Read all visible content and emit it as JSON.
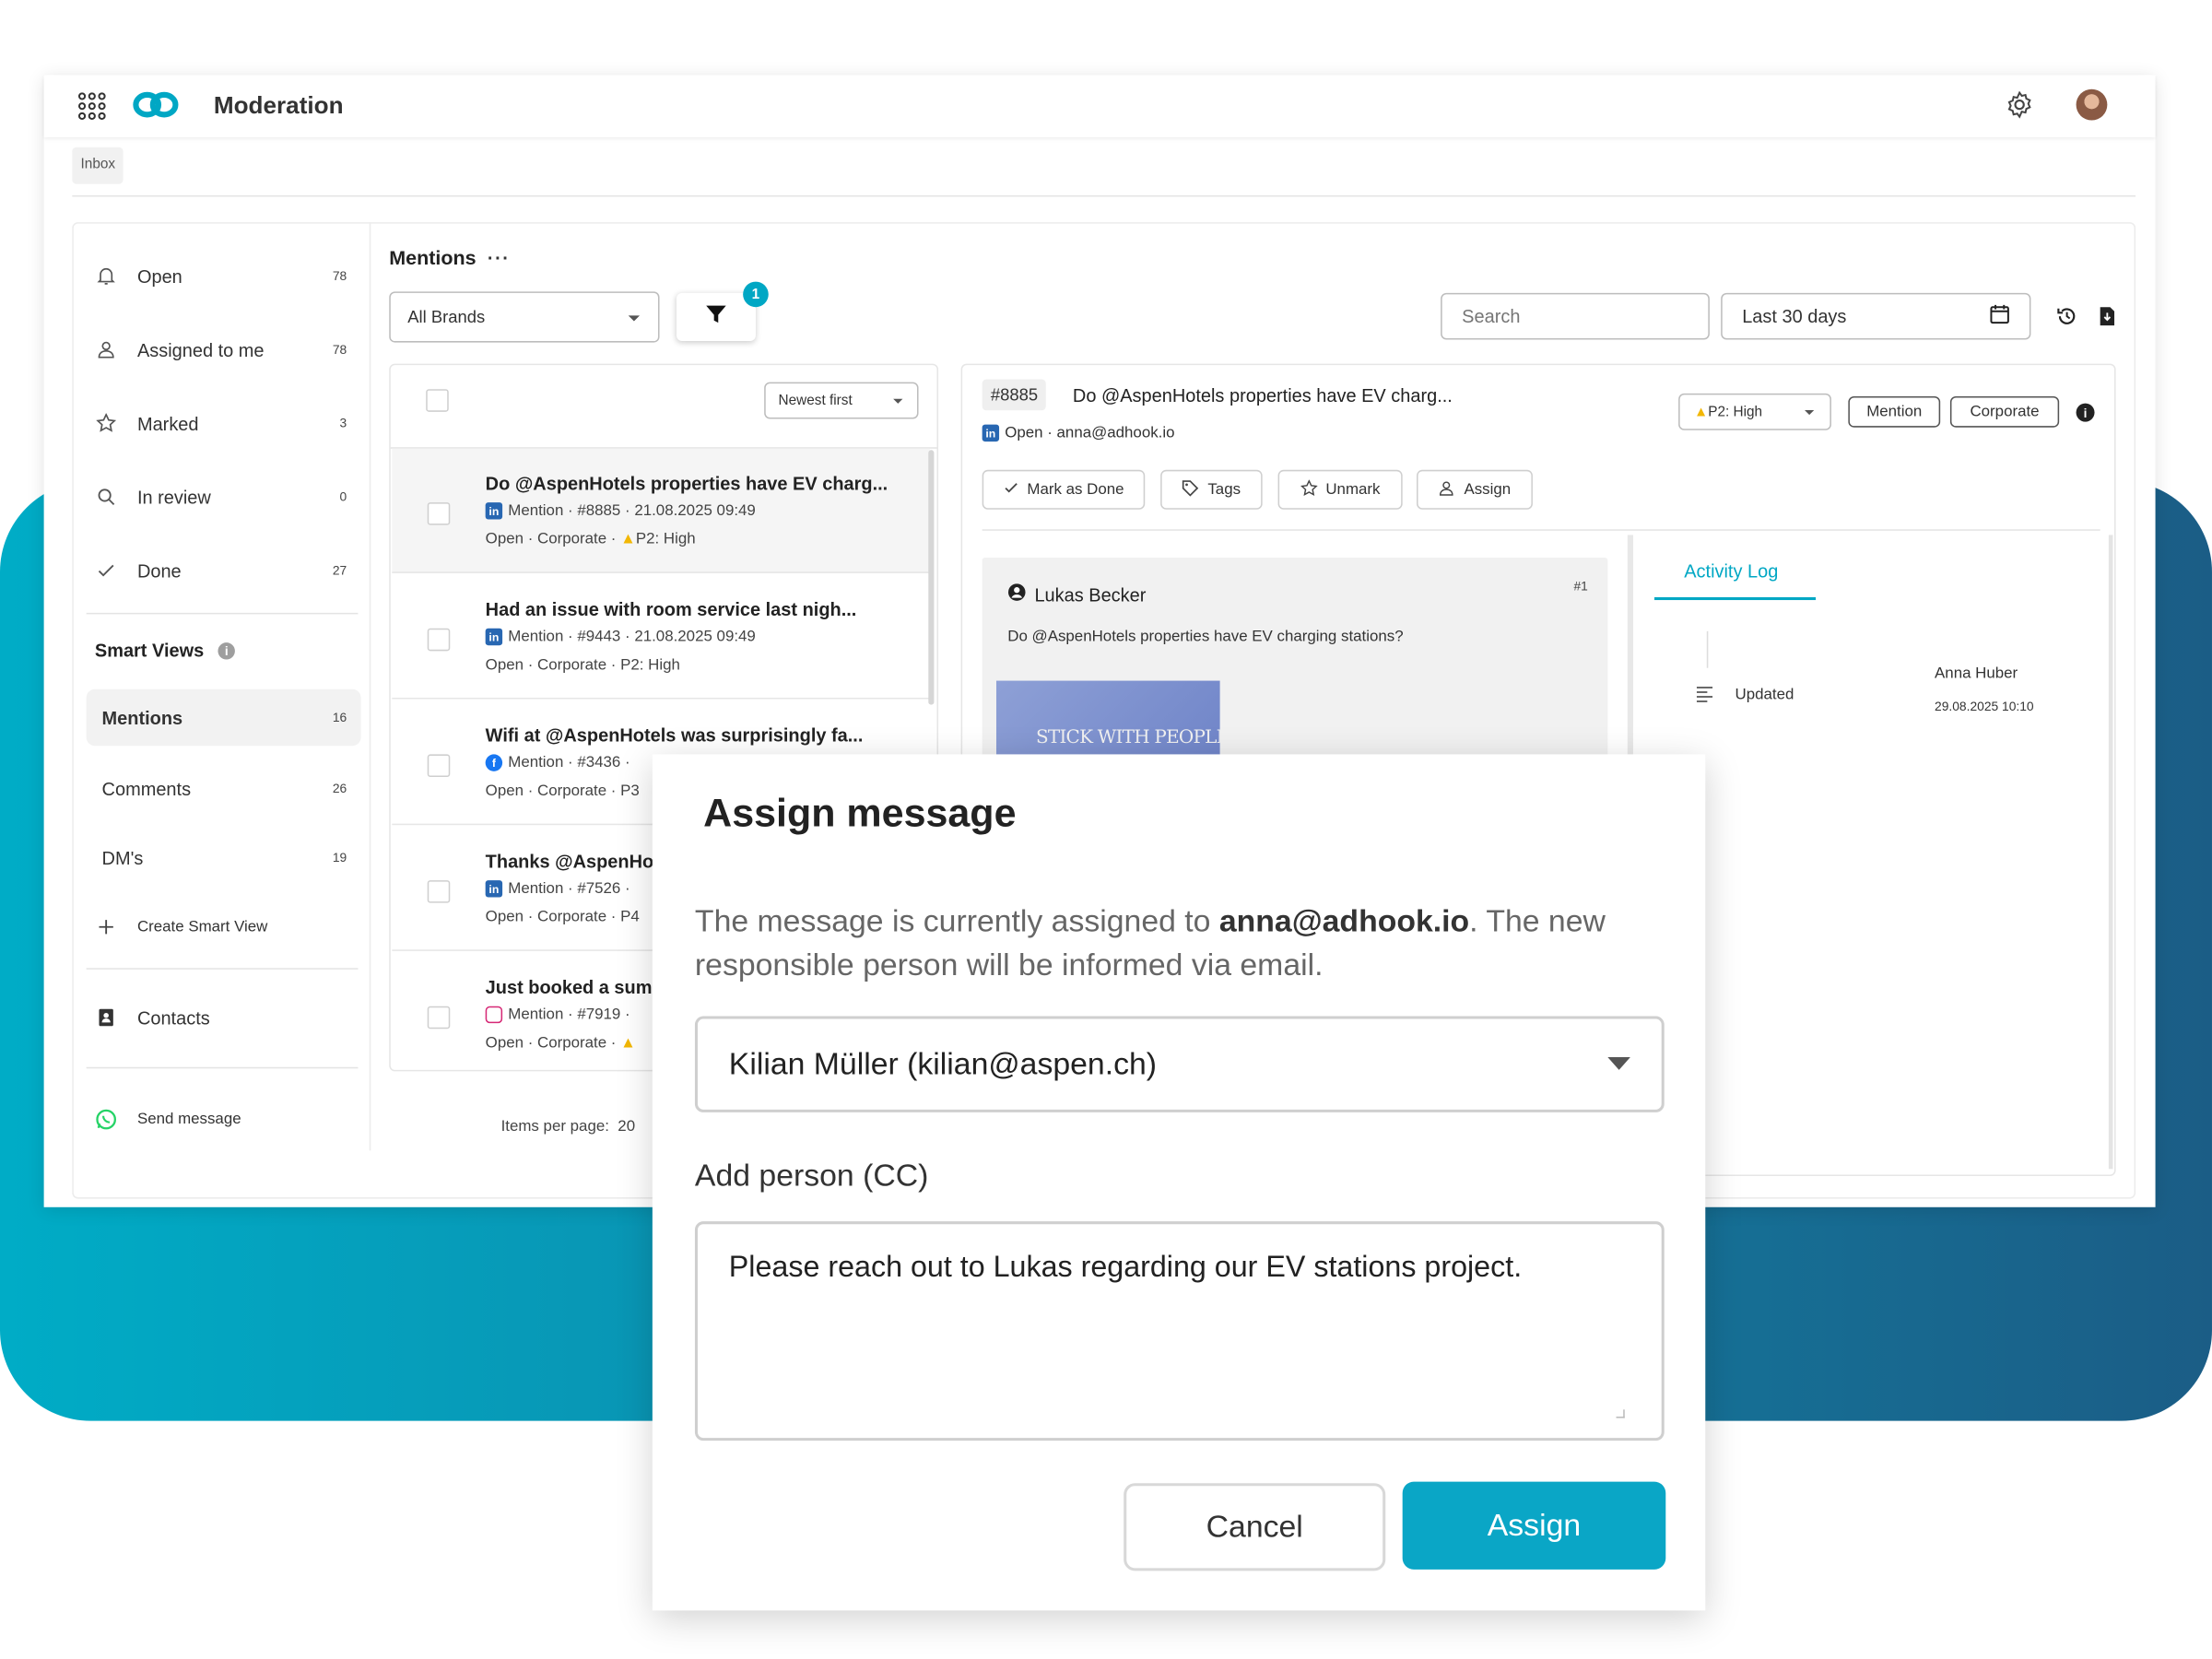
{
  "app": {
    "title": "Moderation",
    "breadcrumb": "Inbox"
  },
  "colors": {
    "accent": "#00a7c4",
    "band_start": "#00acc6",
    "band_end": "#1b5d86",
    "warning": "#f2b705"
  },
  "sidebar": {
    "items": [
      {
        "label": "Open",
        "count": "78",
        "icon": "bell-icon"
      },
      {
        "label": "Assigned to me",
        "count": "78",
        "icon": "user-icon"
      },
      {
        "label": "Marked",
        "count": "3",
        "icon": "star-icon"
      },
      {
        "label": "In review",
        "count": "0",
        "icon": "search-icon"
      },
      {
        "label": "Done",
        "count": "27",
        "icon": "check-icon"
      }
    ],
    "smart_views_title": "Smart Views",
    "smart_views": [
      {
        "label": "Mentions",
        "count": "16"
      },
      {
        "label": "Comments",
        "count": "26"
      },
      {
        "label": "DM's",
        "count": "19"
      }
    ],
    "create_smart_view": "Create Smart View",
    "contacts": "Contacts",
    "send_message": "Send message"
  },
  "main": {
    "title": "Mentions",
    "brand_select": "All Brands",
    "filter_badge": "1",
    "search_placeholder": "Search",
    "date_range": "Last 30 days"
  },
  "list": {
    "sort": "Newest first",
    "items_per_page": "Items per page:  20",
    "items": [
      {
        "title": "Do @AspenHotels properties have EV charg...",
        "network": "linkedin",
        "meta": "Mention  ·  #8885  ·  21.08.2025 09:49",
        "status": "Open  ·  Corporate  ·  ",
        "priority": "P2: High",
        "warn": true
      },
      {
        "title": "Had an issue with room service last nigh...",
        "network": "linkedin",
        "meta": "Mention  ·  #9443  ·  21.08.2025 09:49",
        "status": "Open  ·  Corporate  ·  P2: High",
        "priority": "",
        "warn": false
      },
      {
        "title": "Wifi at @AspenHotels was surprisingly fa...",
        "network": "facebook",
        "meta": "Mention  ·  #3436  ·",
        "status": "Open  ·  Corporate  ·  P3",
        "priority": "",
        "warn": false
      },
      {
        "title": "Thanks @AspenHot",
        "network": "linkedin",
        "meta": "Mention  ·  #7526  ·",
        "status": "Open  ·  Corporate  ·  P4",
        "priority": "",
        "warn": false
      },
      {
        "title": "Just booked a summ",
        "network": "instagram",
        "meta": "Mention  ·  #7919  ·",
        "status": "Open  ·  Corporate  ·",
        "priority": "",
        "warn": true
      }
    ]
  },
  "detail": {
    "id": "#8885",
    "title": "Do @AspenHotels properties have EV charg...",
    "status_line": "Open · anna@adhook.io",
    "priority": "P2: High",
    "tags": [
      "Mention",
      "Corporate"
    ],
    "actions": [
      "Mark as Done",
      "Tags",
      "Unmark",
      "Assign"
    ],
    "message": {
      "author": "Lukas Becker",
      "index": "#1",
      "text": "Do @AspenHotels properties have EV charging stations?",
      "image_caption": "STICK WITH PEOPLE"
    },
    "activity_tab": "Activity Log",
    "activity": {
      "action": "Updated",
      "user": "Anna Huber",
      "time": "29.08.2025 10:10"
    }
  },
  "modal": {
    "title": "Assign message",
    "desc_before": "The message is currently assigned to ",
    "desc_email": "anna@adhook.io",
    "desc_after": ". The new responsible person will be informed via email.",
    "assignee": "Kilian Müller (kilian@aspen.ch)",
    "cc_label": "Add person (CC)",
    "note": "Please reach out to Lukas regarding our EV stations project.",
    "cancel": "Cancel",
    "assign": "Assign"
  }
}
